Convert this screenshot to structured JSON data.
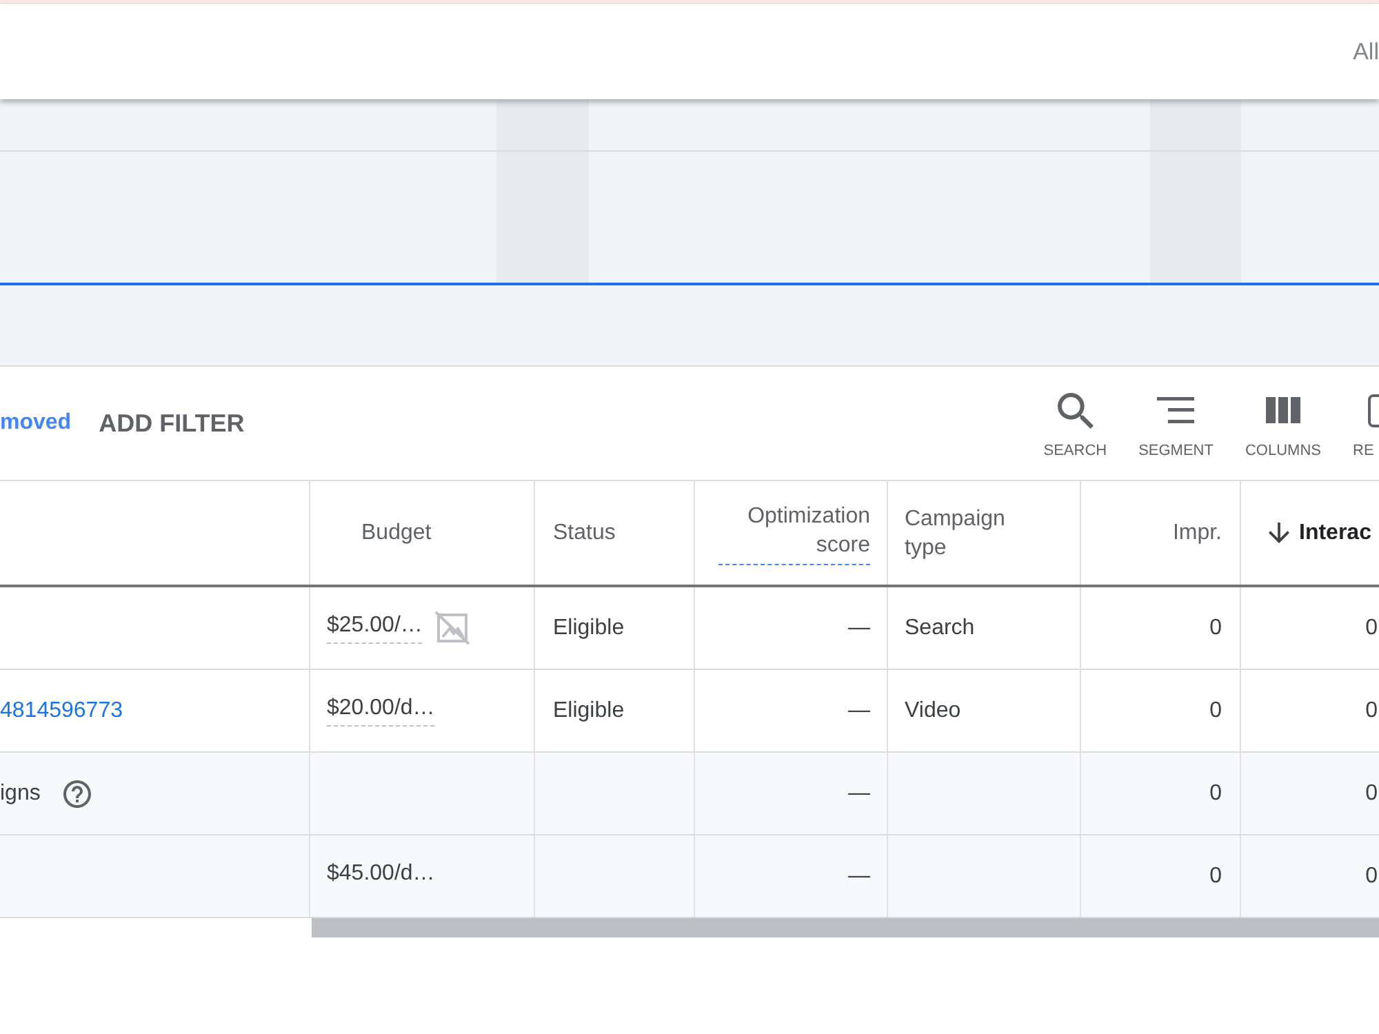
{
  "top_bar": {
    "label": "All"
  },
  "filter_bar": {
    "filter": "moved",
    "add_filter": "ADD FILTER"
  },
  "toolbar": [
    {
      "kind": "search",
      "label": "SEARCH"
    },
    {
      "kind": "segment",
      "label": "SEGMENT"
    },
    {
      "kind": "columns",
      "label": "COLUMNS"
    },
    {
      "kind": "report",
      "label": "RE"
    }
  ],
  "table": {
    "columns": [
      {
        "label": "Budget",
        "sorted": false,
        "help_underline": false
      },
      {
        "label": "Status",
        "sorted": false,
        "help_underline": false
      },
      {
        "label": "Optimization score",
        "sorted": false,
        "help_underline": true
      },
      {
        "label": "Campaign type",
        "sorted": false,
        "help_underline": false
      },
      {
        "label": "Impr.",
        "sorted": false,
        "help_underline": false
      },
      {
        "label": "Interac",
        "sorted": true,
        "help_underline": false
      }
    ],
    "rows": [
      {
        "kind": "campaign",
        "budget_icon": true,
        "help": false,
        "cells": [
          "$25.00/…",
          "Eligible",
          "—",
          "Search",
          "0",
          "0"
        ]
      },
      {
        "kind": "campaign",
        "name": "4814596773",
        "budget_icon": false,
        "help": false,
        "cells": [
          "$20.00/d…",
          "Eligible",
          "—",
          "Video",
          "0",
          "0"
        ]
      },
      {
        "kind": "total",
        "name": "igns",
        "budget_icon": false,
        "help": true,
        "cells": [
          null,
          null,
          "—",
          null,
          "0",
          "0"
        ]
      },
      {
        "kind": "total",
        "budget_icon": false,
        "help": false,
        "cells": [
          "$45.00/d…",
          null,
          "—",
          null,
          "0",
          "0"
        ]
      }
    ]
  }
}
